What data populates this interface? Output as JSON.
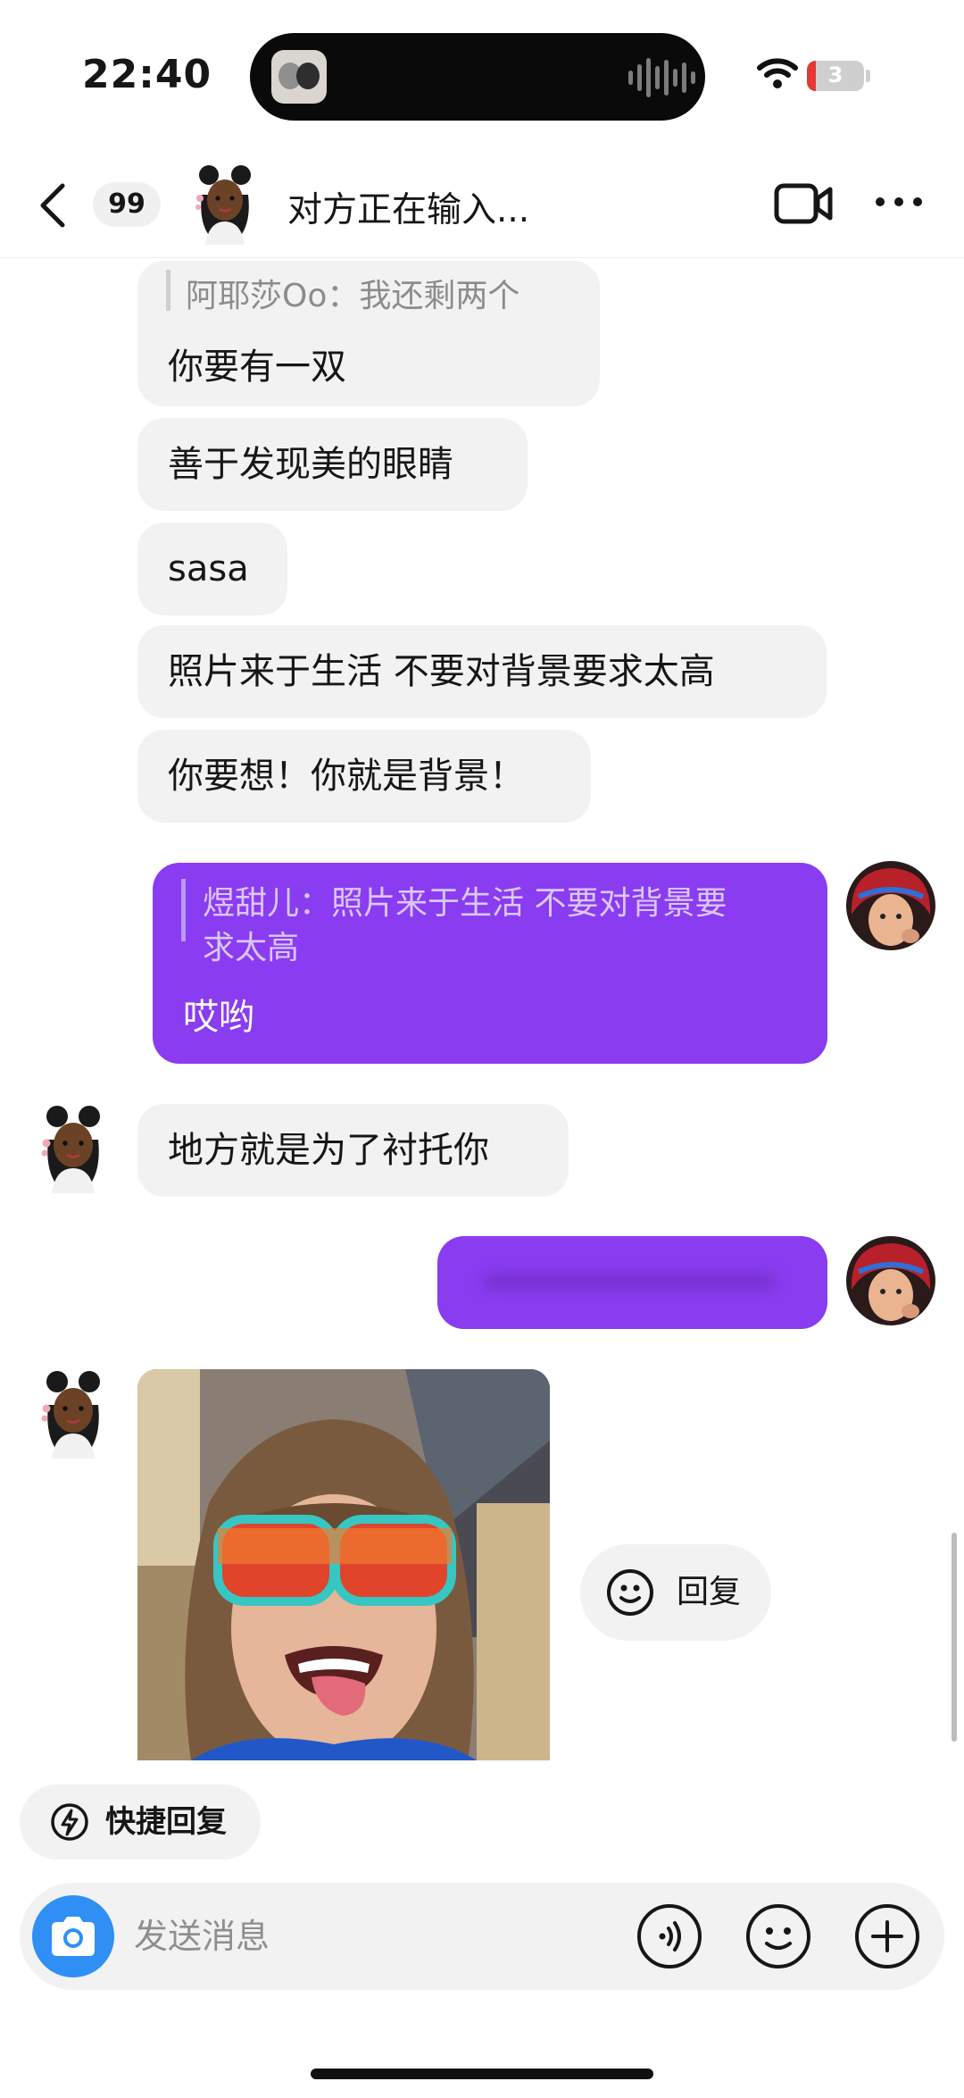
{
  "status_bar": {
    "time": "22:40",
    "battery": "3"
  },
  "header": {
    "unread_count": "99",
    "title": "对方正在输入..."
  },
  "messages": {
    "m1": {
      "quote": "阿耶莎Oo：我还剩两个",
      "text": "你要有一双"
    },
    "m2": {
      "text": "善于发现美的眼睛"
    },
    "m3": {
      "text": "sasa"
    },
    "m4": {
      "text": "照片来于生活 不要对背景要求太高"
    },
    "m5": {
      "text": "你要想！你就是背景！"
    },
    "m6": {
      "quote_line1": "煜甜儿：照片来于生活 不要对背景要",
      "quote_line2": "求太高",
      "text": "哎哟"
    },
    "m7": {
      "text": "地方就是为了衬托你"
    }
  },
  "reply_button": {
    "label": "回复"
  },
  "quick_reply": {
    "label": "快捷回复"
  },
  "composer": {
    "placeholder": "发送消息"
  },
  "colors": {
    "outgoing_bubble": "#8a3cf0",
    "camera_button": "#2f8ff5"
  }
}
